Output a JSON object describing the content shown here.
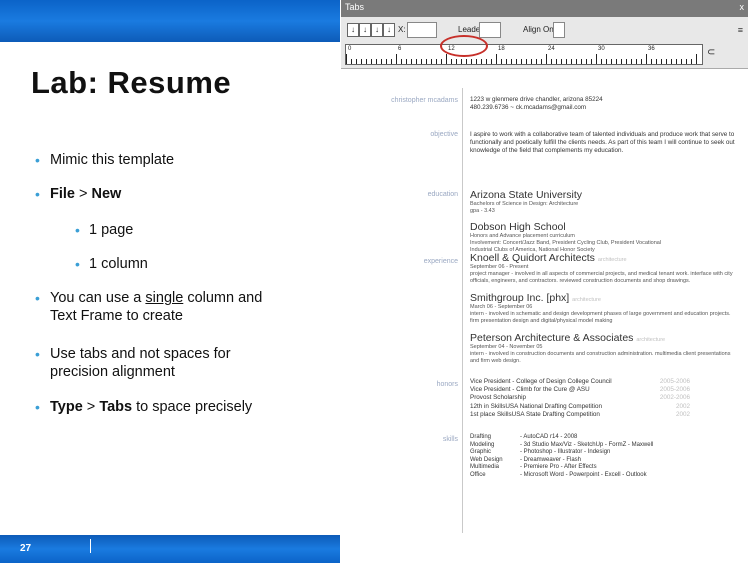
{
  "slide": {
    "title": "Lab:  Resume",
    "page_number": "27",
    "bullets": [
      {
        "text": "Mimic this template"
      },
      {
        "pre": "",
        "b1": "File",
        "mid": " > ",
        "b2": "New"
      },
      {
        "text": "1 page"
      },
      {
        "text": "1 column"
      },
      {
        "pre": "You can use a ",
        "u": "single",
        "post": "  column  and",
        "line2": "Text Frame to create"
      },
      {
        "text": "Use tabs and not spaces for",
        "line2": "precision alignment"
      },
      {
        "b1": "Type",
        "mid": " > ",
        "b2": "Tabs",
        "post": " to space precisely"
      }
    ]
  },
  "tabs_panel": {
    "title": "Tabs",
    "close": "x",
    "x_label": "X:",
    "leader_label": "Leader:",
    "align_label": "Align On:",
    "menu_icon": "≡",
    "ruler_numbers": [
      "0",
      "6",
      "12",
      "18",
      "24",
      "30",
      "36"
    ],
    "tab_buttons": [
      "↓",
      "↓",
      "↓",
      "↓"
    ]
  },
  "resume": {
    "name_label": "christopher mcadams",
    "address_line1": "1223 w glenmere drive chandler, arizona 85224",
    "address_line2": "480.239.6736  ~ ck.mcadams@gmail.com",
    "objective_label": "objective",
    "objective_text": "I aspire to work with a collaborative team of talented individuals and produce work that serve to functionally and poetically fulfill the clients needs.  As part of this team I will continue to seek out knowledge of the field that complements my education.",
    "education_label": "education",
    "edu1_title": "Arizona State University",
    "edu1_sub1": "Bachelors of Science in Design: Architecture",
    "edu1_sub2": "gpa - 3.43",
    "edu2_title": "Dobson High School",
    "edu2_sub1": "Honors and Advance placement curriculum",
    "edu2_sub2": "Involvement: Concert/Jazz Band, President Cycling Club, President Vocational",
    "edu2_sub3": "Industrial Clubs of America, National Honor Society",
    "experience_label": "experience",
    "exp1_title": "Knoell & Quidort Architects",
    "exp1_faint": "architecture",
    "exp1_date": "September 06 - Present",
    "exp1_text": "project manager - involved in all aspects of commercial projects, and medical tenant work. interface with city officials, engineers, and contractors.  reviewed construction documents and shop drawings.",
    "exp2_title": "Smithgroup Inc. [phx]",
    "exp2_faint": "architecture",
    "exp2_date": "March 06 - September 06",
    "exp2_text": "intern - involved in schematic and design development phases of large government and education projects. firm presentation design and digital/physical model making",
    "exp3_title": "Peterson Architecture & Associates",
    "exp3_faint": "architecture",
    "exp3_date": "September 04 - November 05",
    "exp3_text": "intern - involved in construction documents and construction administration. multimedia client presentations and firm web design.",
    "honors_label": "honors",
    "honors": [
      {
        "text": "Vice President - College of Design College Council",
        "year": "2005-2006"
      },
      {
        "text": "Vice President - Climb for the Cure @ ASU",
        "year": "2005-2006"
      },
      {
        "text": "Provost Scholarship",
        "year": "2002-2006"
      },
      {
        "text": "12th in SkillsUSA National Drafting Competition",
        "year": "2002"
      },
      {
        "text": "1st place SkillsUSA State Drafting Competition",
        "year": "2002"
      }
    ],
    "skills_label": "skills",
    "skills": [
      {
        "cat": "Drafting",
        "val": "- AutoCAD r14 - 2008"
      },
      {
        "cat": "Modeling",
        "val": "- 3d Studio Max/Viz - SketchUp - FormZ - Maxwell"
      },
      {
        "cat": "Graphic",
        "val": "- Photoshop - Illustrator - Indesign"
      },
      {
        "cat": "Web Design",
        "val": "- Dreamweaver - Flash"
      },
      {
        "cat": "Multimedia",
        "val": "- Premiere Pro - After Effects"
      },
      {
        "cat": "Office",
        "val": "- Microsoft Word - Powerpoint - Excell - Outlook"
      }
    ]
  },
  "colors": {
    "band": "#0b63c8",
    "bullet": "#3a9fd6",
    "label": "#9aa8c2",
    "circle": "#c7302a"
  }
}
